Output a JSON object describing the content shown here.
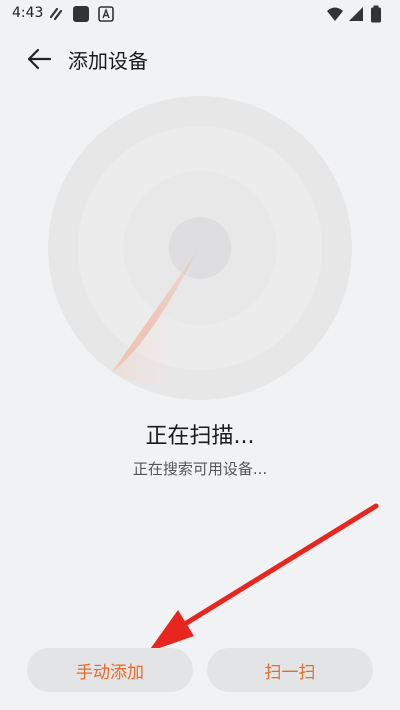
{
  "status_bar": {
    "time": "4:43",
    "left_icons": [
      "link-icon",
      "app-square-icon",
      "a-badge-icon"
    ],
    "right_icons": [
      "wifi-icon",
      "signal-icon",
      "battery-icon"
    ]
  },
  "header": {
    "title": "添加设备",
    "back_icon": "back-arrow-icon"
  },
  "scan": {
    "title": "正在扫描...",
    "subtitle": "正在搜索可用设备..."
  },
  "buttons": {
    "manual_add": "手动添加",
    "scan_qr": "扫一扫"
  },
  "colors": {
    "accent": "#e86a2c",
    "background": "#f1f2f4",
    "button_bg": "#e3e4e6",
    "annotation_arrow": "#e8261f"
  }
}
